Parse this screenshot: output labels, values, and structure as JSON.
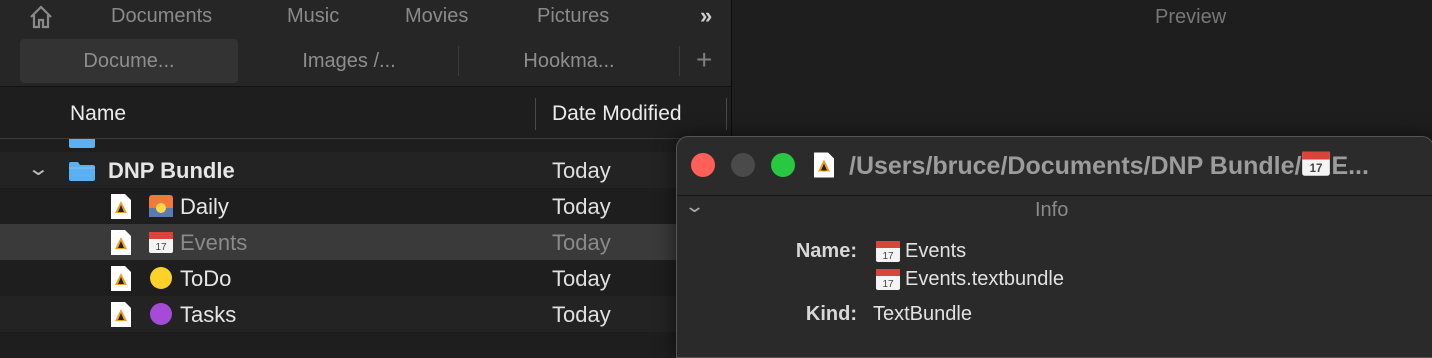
{
  "favorites": {
    "items": [
      "Documents",
      "Music",
      "Movies",
      "Pictures"
    ]
  },
  "tabs": [
    "Docume...",
    "Images /...",
    "Hookma..."
  ],
  "columns": {
    "name": "Name",
    "date": "Date Modified"
  },
  "rows": [
    {
      "name": "DNP Bundle",
      "date": "Today",
      "kind": "folder"
    },
    {
      "name": "Daily",
      "date": "Today",
      "emoji": "sunrise"
    },
    {
      "name": "Events",
      "date": "Today",
      "emoji": "calendar"
    },
    {
      "name": "ToDo",
      "date": "Today",
      "emoji": "yellow-circle"
    },
    {
      "name": "Tasks",
      "date": "Today",
      "emoji": "purple-circle"
    }
  ],
  "preview": {
    "title": "Preview"
  },
  "info_window": {
    "title": "/Users/bruce/Documents/DNP Bundle/",
    "title_suffix": "E...",
    "section": "Info",
    "name_label": "Name:",
    "name_value": "Events",
    "name_value_2": "Events.textbundle",
    "kind_label": "Kind:",
    "kind_value": "TextBundle"
  },
  "colors": {
    "red": "#ff5f57",
    "green": "#28c840",
    "folder": "#5ab0f0"
  }
}
